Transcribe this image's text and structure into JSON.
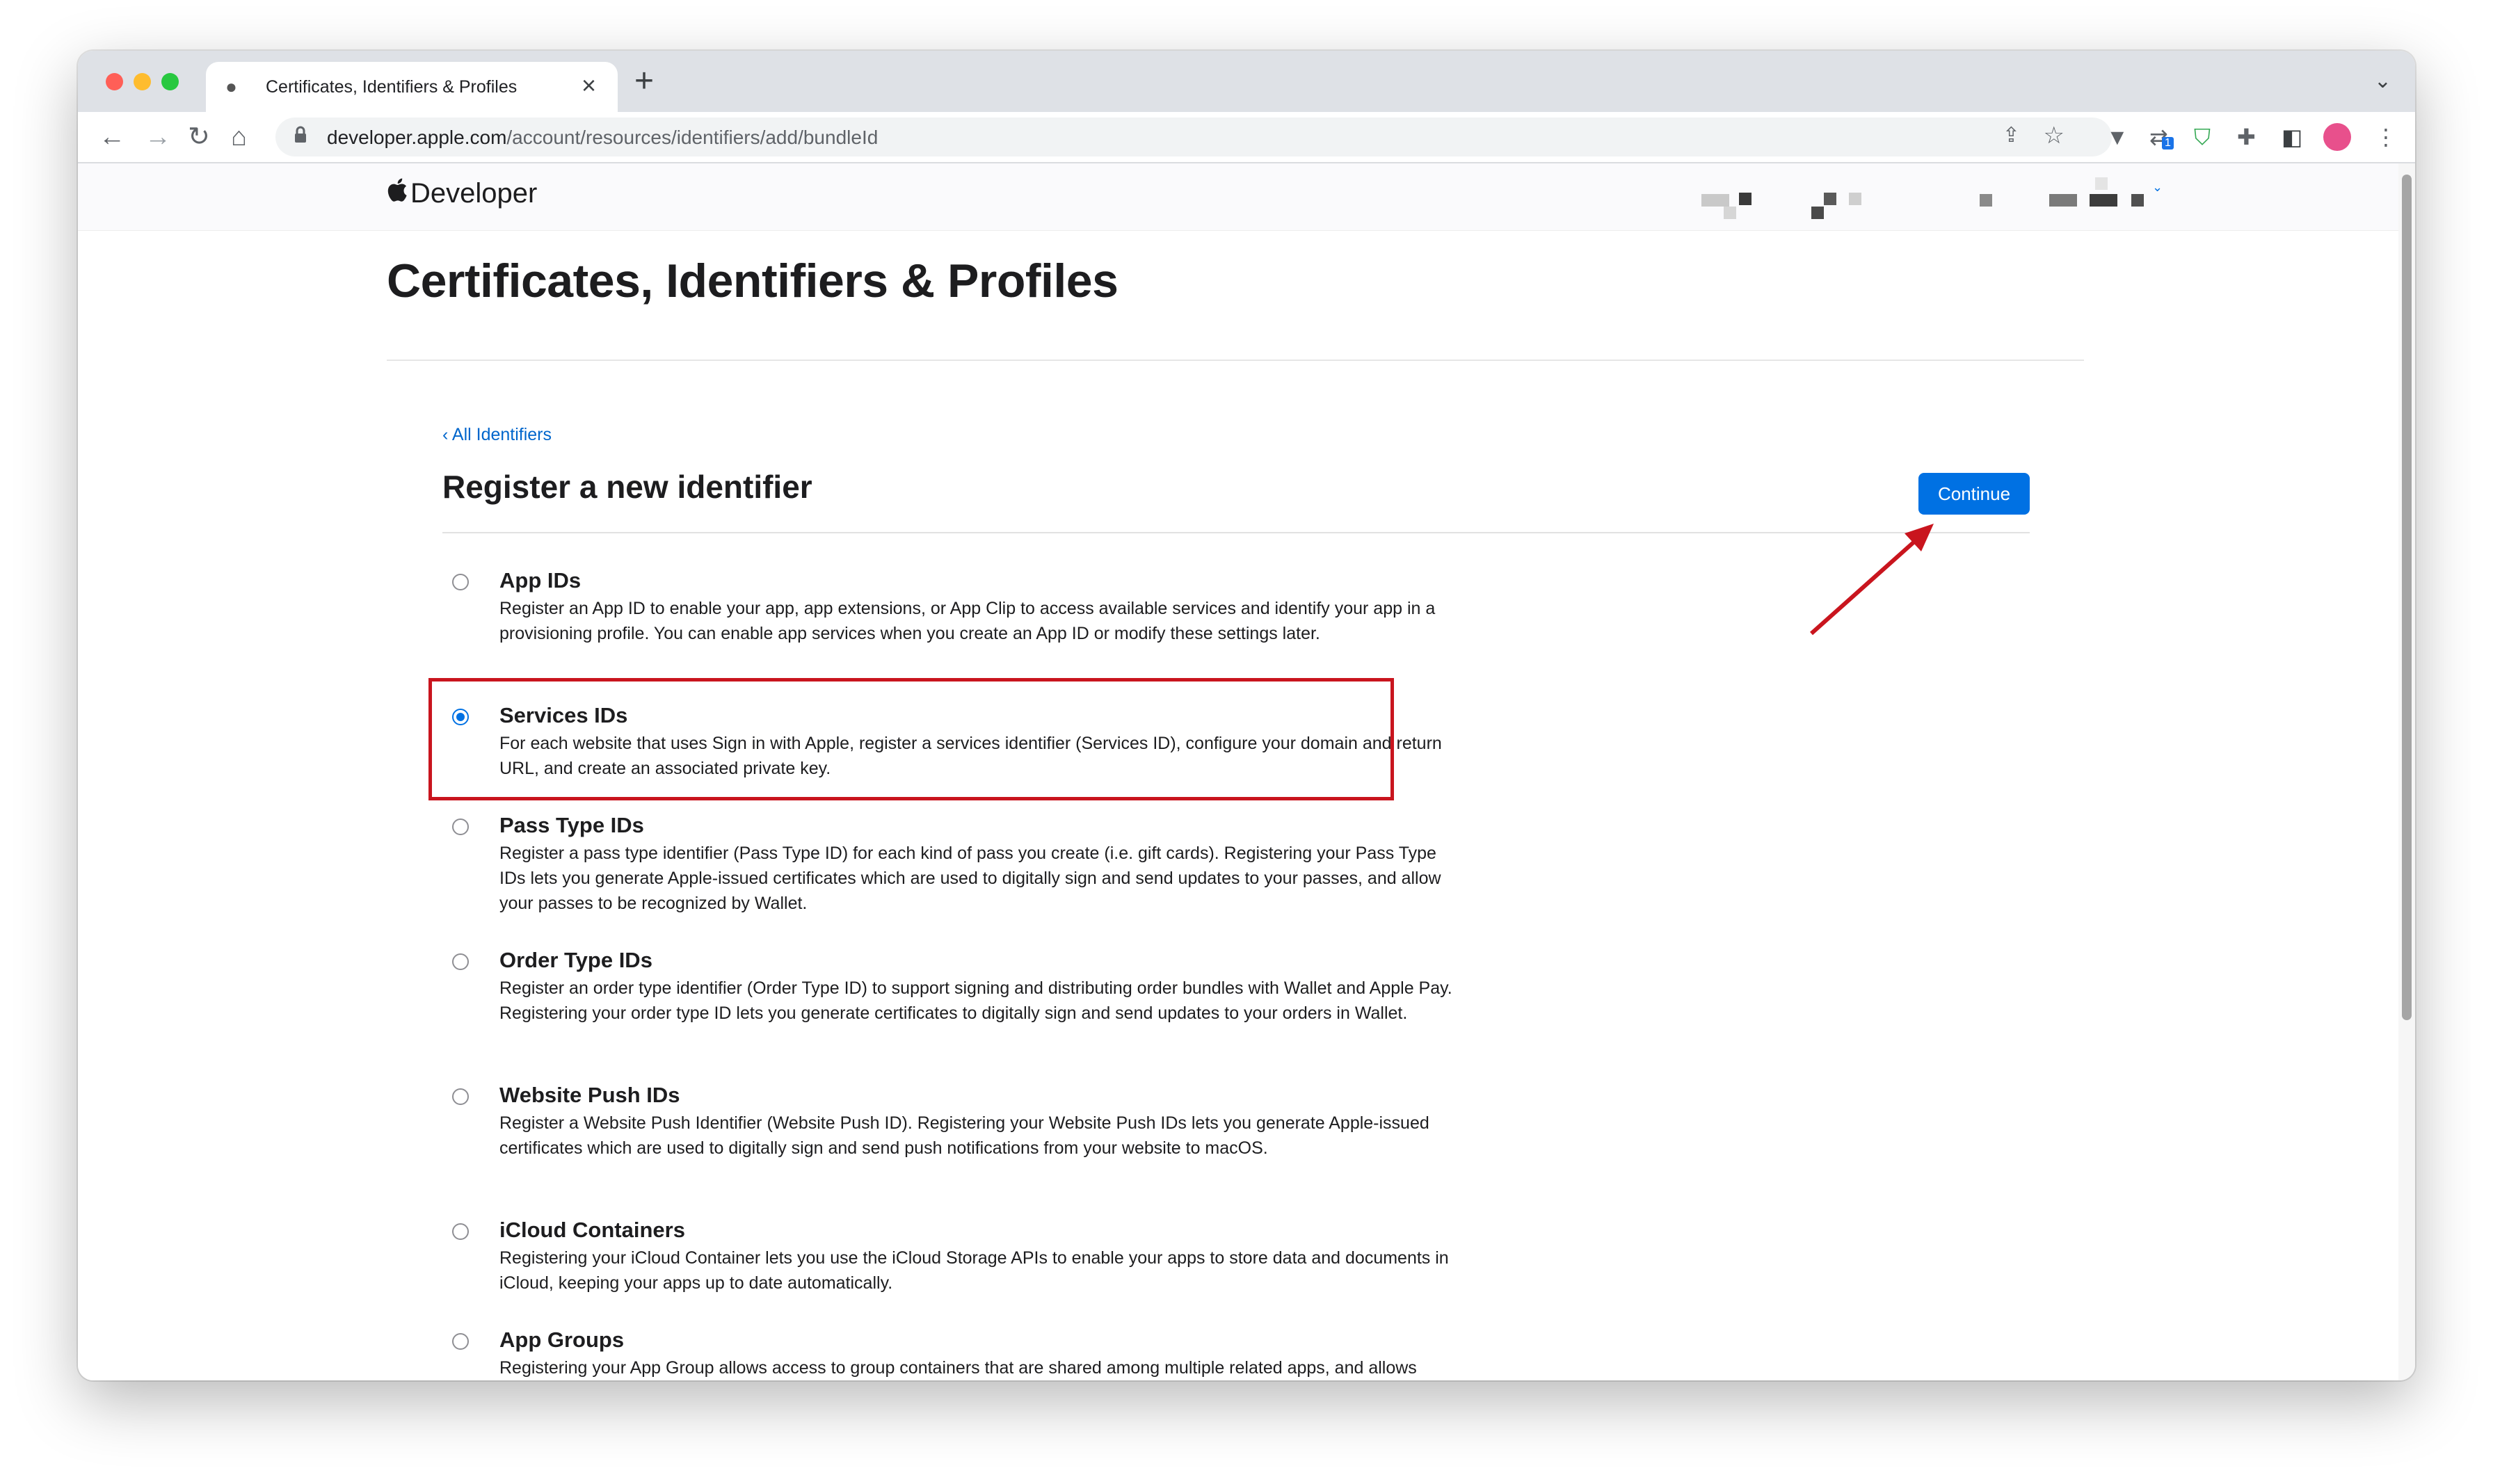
{
  "browser": {
    "tab_title": "Certificates, Identifiers & Profiles",
    "new_tab_glyph": "+",
    "url_host": "developer.apple.com",
    "url_path": "/account/resources/identifiers/add/bundleId",
    "extension_badge": "1"
  },
  "header": {
    "brand": "Developer"
  },
  "page": {
    "title": "Certificates, Identifiers & Profiles",
    "back_link": "‹ All Identifiers",
    "section_title": "Register a new identifier",
    "continue_label": "Continue"
  },
  "options": [
    {
      "title": "App IDs",
      "desc": "Register an App ID to enable your app, app extensions, or App Clip to access available services and identify your app in a provisioning profile. You can enable app services when you create an App ID or modify these settings later.",
      "selected": false
    },
    {
      "title": "Services IDs",
      "desc": "For each website that uses Sign in with Apple, register a services identifier (Services ID), configure your domain and return URL, and create an associated private key.",
      "selected": true
    },
    {
      "title": "Pass Type IDs",
      "desc": "Register a pass type identifier (Pass Type ID) for each kind of pass you create (i.e. gift cards). Registering your Pass Type IDs lets you generate Apple-issued certificates which are used to digitally sign and send updates to your passes, and allow your passes to be recognized by Wallet.",
      "selected": false
    },
    {
      "title": "Order Type IDs",
      "desc": "Register an order type identifier (Order Type ID) to support signing and distributing order bundles with Wallet and Apple Pay. Registering your order type ID lets you generate certificates to digitally sign and send updates to your orders in Wallet.",
      "selected": false
    },
    {
      "title": "Website Push IDs",
      "desc": "Register a Website Push Identifier (Website Push ID). Registering your Website Push IDs lets you generate Apple-issued certificates which are used to digitally sign and send push notifications from your website to macOS.",
      "selected": false
    },
    {
      "title": "iCloud Containers",
      "desc": "Registering your iCloud Container lets you use the iCloud Storage APIs to enable your apps to store data and documents in iCloud, keeping your apps up to date automatically.",
      "selected": false
    },
    {
      "title": "App Groups",
      "desc": "Registering your App Group allows access to group containers that are shared among multiple related apps, and allows certain additional interprocess communication between the apps.",
      "selected": false
    }
  ],
  "colors": {
    "accent": "#0071e3",
    "annotation": "#c9151e",
    "link": "#0066cc"
  },
  "icons": {
    "back": "arrow-left-icon",
    "forward": "arrow-right-icon",
    "reload": "reload-icon",
    "home": "home-icon",
    "lock": "lock-icon",
    "share": "share-icon",
    "bookmark": "star-icon",
    "extensions": "puzzle-icon",
    "menu": "kebab-menu-icon"
  }
}
